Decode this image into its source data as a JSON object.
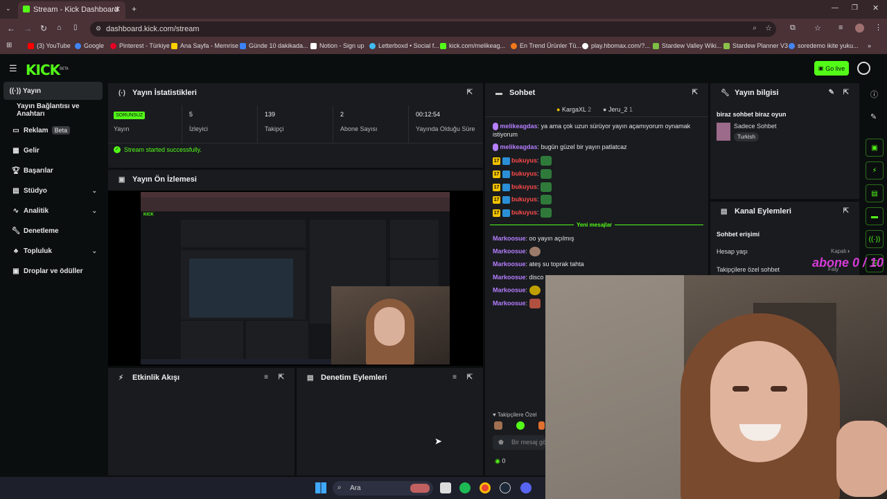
{
  "browser": {
    "tab_title": "Stream - Kick Dashboard",
    "url": "dashboard.kick.com/stream",
    "bookmarks": [
      "(3) YouTube",
      "Google",
      "Pinterest - Türkiye",
      "Ana Sayfa - Memrise",
      "Günde 10 dakikada...",
      "Notion - Sign up",
      "Letterboxd • Social f...",
      "kick.com/melikeag...",
      "En Trend Ürünler Tü...",
      "play.hbomax.com/?...",
      "Stardew Valley Wiki...",
      "Stardew Planner V3",
      "soredemo ikite yuku..."
    ]
  },
  "header": {
    "logo": "KICK",
    "beta": "BETA",
    "go_live": "Go live"
  },
  "sidebar": {
    "items": [
      {
        "label": "Yayın",
        "icon": "broadcast-icon"
      },
      {
        "label": "Yayın Bağlantısı ve Anahtarı"
      },
      {
        "label": "Reklam",
        "badge": "Beta",
        "icon": "ad-icon"
      },
      {
        "label": "Gelir",
        "icon": "revenue-icon"
      },
      {
        "label": "Başarılar",
        "icon": "trophy-icon"
      },
      {
        "label": "Stüdyo",
        "icon": "studio-icon"
      },
      {
        "label": "Analitik",
        "icon": "analytics-icon"
      },
      {
        "label": "Denetleme",
        "icon": "wrench-icon"
      },
      {
        "label": "Topluluk",
        "icon": "community-icon"
      },
      {
        "label": "Droplar ve ödüller",
        "icon": "gift-icon"
      }
    ]
  },
  "stats": {
    "title": "Yayın İstatistikleri",
    "status_badge": "SORUNSUZ",
    "status_label": "Yayın",
    "viewers": "5",
    "viewers_label": "İzleyici",
    "followers": "139",
    "followers_label": "Takipçi",
    "subs": "2",
    "subs_label": "Abone Sayısı",
    "uptime": "00:12:54",
    "uptime_label": "Yayında Olduğu Süre",
    "message": "Stream started successfully."
  },
  "preview": {
    "title": "Yayın Ön İzlemesi"
  },
  "activity": {
    "title": "Etkinlik Akışı"
  },
  "moderation": {
    "title": "Denetim Eylemleri"
  },
  "chat": {
    "title": "Sohbet",
    "top1": "KargaXL",
    "top1_count": "2",
    "top2": "Jeru_2",
    "top2_count": "1",
    "messages": [
      {
        "user": "melikeagdas",
        "text": "ya ama çok uzun sürüyor yayın açamıyorum oynamak istiyorum"
      },
      {
        "user": "melikeagdas",
        "text": "bugün güzel bir yayın patlatcaz"
      },
      {
        "user": "bukuyus",
        "badge": "17"
      },
      {
        "user": "bukuyus",
        "badge": "17"
      },
      {
        "user": "bukuyus",
        "badge": "17"
      },
      {
        "user": "bukuyus",
        "badge": "17"
      },
      {
        "user": "bukuyus",
        "badge": "17"
      }
    ],
    "new_messages": "Yeni mesajlar",
    "messages2": [
      {
        "user": "Markoosue",
        "text": "oo yayın açılmış"
      },
      {
        "user": "Markoosue",
        "text": ""
      },
      {
        "user": "Markoosue",
        "text": "ateş su toprak tahta"
      },
      {
        "user": "Markoosue",
        "text": "disco ..."
      },
      {
        "user": "Markoosue",
        "text": ""
      },
      {
        "user": "Markoosue",
        "text": ""
      }
    ],
    "followers_only": "Takipçilere Özel",
    "input_placeholder": "Bir mesaj gö",
    "points": "0"
  },
  "stream_info": {
    "title": "Yayın bilgisi",
    "stream_title": "biraz sohbet biraz oyun",
    "category": "Sadece Sohbet",
    "language": "Turkish"
  },
  "channel_actions": {
    "title": "Kanal Eylemleri",
    "section": "Sohbet erişimi",
    "row1": "Hesap yaşı",
    "row1_value": "Kapalı",
    "row2": "Takipçilere özel sohbet",
    "row2_value": "Faly"
  },
  "overlay": {
    "text": "abone 0 / 10"
  },
  "taskbar": {
    "search": "Ara"
  }
}
